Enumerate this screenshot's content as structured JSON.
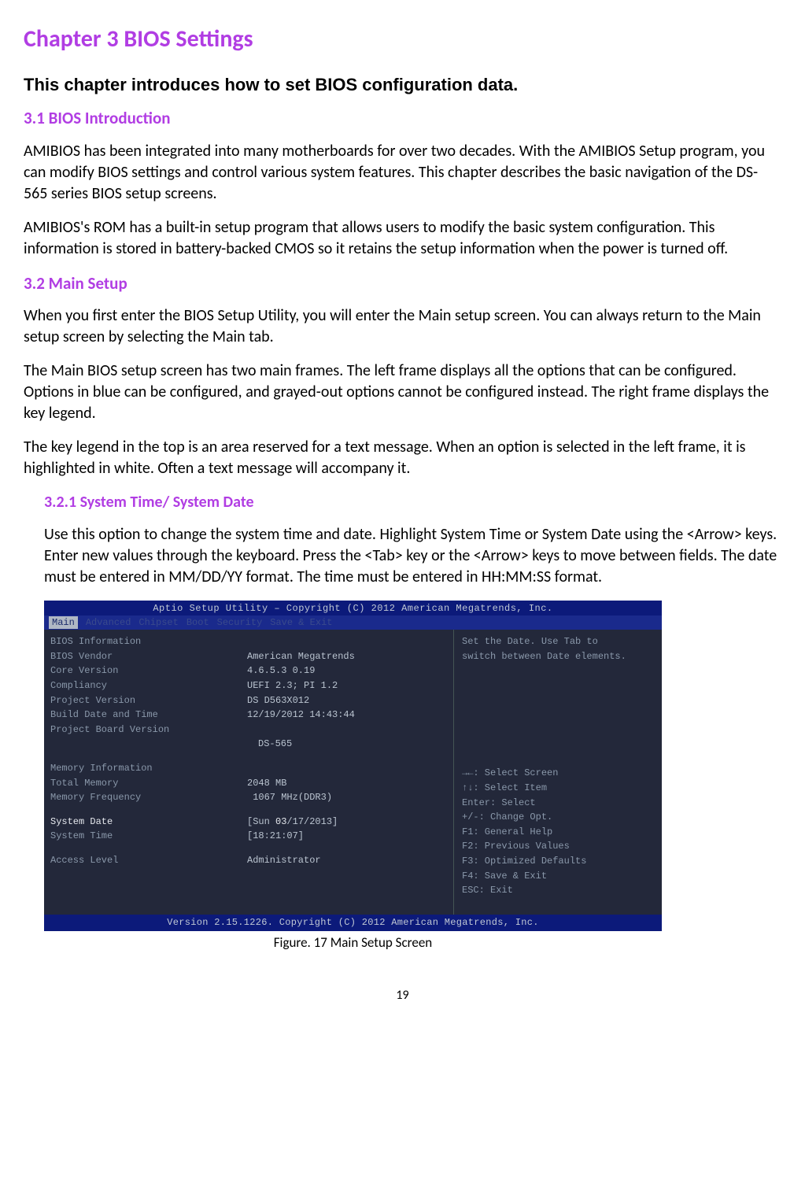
{
  "chapter_title": "Chapter 3 BIOS Settings",
  "intro_bold": "This chapter introduces how to set BIOS configuration data.",
  "s31": {
    "heading": "3.1  BIOS Introduction",
    "p1": "AMIBIOS has been integrated into many motherboards for over two decades. With the AMIBIOS Setup program, you can modify BIOS settings and control various system features. This chapter describes the basic navigation of the DS-565 series BIOS setup screens.",
    "p2": "AMIBIOS's ROM has a built-in setup program that allows users to modify the basic system configuration. This information is stored in battery-backed CMOS so it retains the setup information when the power is turned off."
  },
  "s32": {
    "heading": "3.2  Main Setup",
    "p1": "When you first enter the BIOS Setup Utility, you will enter the Main setup screen. You can always return to the Main setup screen by selecting the Main tab.",
    "p2": "The Main BIOS setup screen has two main frames. The left frame displays all the options that can be configured. Options in blue can be configured, and grayed-out options cannot be configured instead. The right frame displays the key legend.",
    "p3": "The key legend in the top is an area reserved for a text message. When an option is selected in the left frame, it is highlighted in white. Often a text message will accompany it."
  },
  "s321": {
    "heading": "3.2.1     System Time/ System Date",
    "p1": "Use this option to change the system time and date. Highlight System Time or System Date using the <Arrow> keys. Enter new values through the keyboard. Press the <Tab> key or the <Arrow> keys to move between fields. The date must be entered in MM/DD/YY format. The time must be entered in HH:MM:SS format."
  },
  "bios": {
    "title": "Aptio Setup Utility – Copyright (C) 2012 American Megatrends, Inc.",
    "tabs": [
      "Main",
      "Advanced",
      "Chipset",
      "Boot",
      "Security",
      "Save & Exit"
    ],
    "left": {
      "section1": "BIOS Information",
      "vendor_label": "BIOS Vendor",
      "vendor_val": "American Megatrends",
      "core_label": "Core Version",
      "core_val": "4.6.5.3   0.19",
      "compliancy_label": "Compliancy",
      "compliancy_val": "UEFI 2.3; PI 1.2",
      "project_label": "Project Version",
      "project_val": "DS D563X012",
      "build_label": "Build Date and Time",
      "build_val": "12/19/2012 14:43:44",
      "board_label": "Project Board Version",
      "board_val": "DS-565",
      "section2": "Memory Information",
      "totalmem_label": "Total Memory",
      "totalmem_val": "2048 MB",
      "memfreq_label": "Memory Frequency",
      "memfreq_val": "1067 MHz(DDR3)",
      "sysdate_label": "System Date",
      "sysdate_val_pre": "[Sun ",
      "sysdate_val_hl": "03",
      "sysdate_val_post": "/17/2013]",
      "systime_label": "System Time",
      "systime_val": "[18:21:07]",
      "access_label": "Access Level",
      "access_val": "Administrator"
    },
    "right": {
      "help1": "Set the Date. Use Tab to",
      "help2": "switch between Date elements.",
      "keys": [
        "→←: Select Screen",
        "↑↓: Select Item",
        "Enter: Select",
        "+/-: Change Opt.",
        "F1: General Help",
        "F2: Previous Values",
        "F3: Optimized Defaults",
        "F4: Save & Exit",
        "ESC: Exit"
      ]
    },
    "footer": "Version 2.15.1226. Copyright (C) 2012 American Megatrends, Inc."
  },
  "figure_caption": "Figure. 17 Main Setup Screen",
  "page_number": "19"
}
